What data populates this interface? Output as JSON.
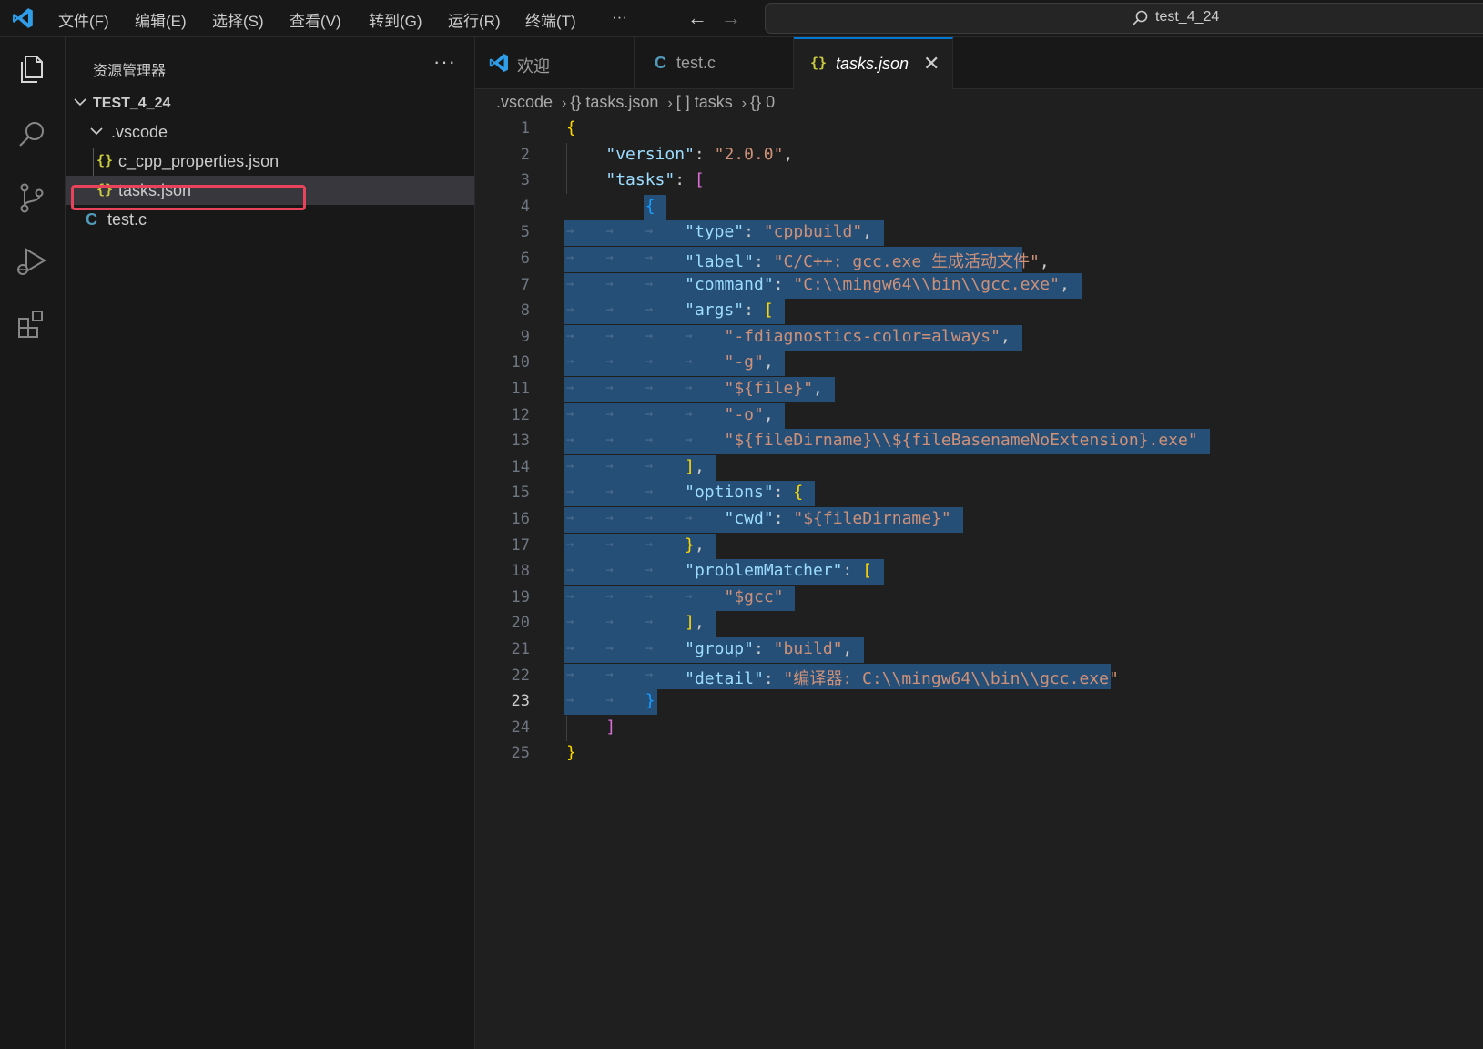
{
  "titlebar": {
    "menus": [
      "文件(F)",
      "编辑(E)",
      "选择(S)",
      "查看(V)",
      "转到(G)",
      "运行(R)",
      "终端(T)",
      "···"
    ],
    "search_text": "test_4_24"
  },
  "sidebar": {
    "title": "资源管理器",
    "more": "···",
    "root": "TEST_4_24",
    "folder": ".vscode",
    "files": [
      "c_cpp_properties.json",
      "tasks.json",
      "test.c"
    ]
  },
  "tabs": [
    {
      "label": "欢迎",
      "icon": "vscode-logo-icon"
    },
    {
      "label": "test.c",
      "icon": "c-file-icon",
      "icon_text": "C"
    },
    {
      "label": "tasks.json",
      "icon": "json-file-icon",
      "icon_text": "{}",
      "active": true,
      "close": "✕"
    }
  ],
  "breadcrumb": [
    ".vscode",
    "{} tasks.json",
    "[ ] tasks",
    "{} 0"
  ],
  "editor": {
    "current_line": 23,
    "lines": [
      "{",
      "    \"version\": \"2.0.0\",",
      "    \"tasks\": [",
      "        {",
      "            \"type\": \"cppbuild\",",
      "            \"label\": \"C/C++: gcc.exe 生成活动文件\",",
      "            \"command\": \"C:\\\\mingw64\\\\bin\\\\gcc.exe\",",
      "            \"args\": [",
      "                \"-fdiagnostics-color=always\",",
      "                \"-g\",",
      "                \"${file}\",",
      "                \"-o\",",
      "                \"${fileDirname}\\\\${fileBasenameNoExtension}.exe\"",
      "            ],",
      "            \"options\": {",
      "                \"cwd\": \"${fileDirname}\"",
      "            },",
      "            \"problemMatcher\": [",
      "                \"$gcc\"",
      "            ],",
      "            \"group\": \"build\",",
      "            \"detail\": \"编译器: C:\\\\mingw64\\\\bin\\\\gcc.exe\"",
      "        }",
      "    ]",
      "}"
    ]
  },
  "colors": {
    "accent": "#0078d4",
    "selection": "#264f78",
    "highlight_box": "#e8435a",
    "json_icon": "#cbcb41",
    "c_icon": "#519aba"
  }
}
